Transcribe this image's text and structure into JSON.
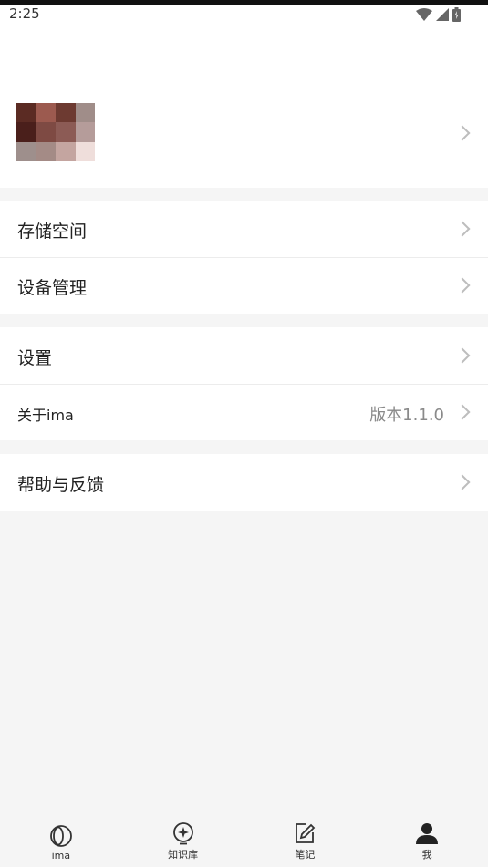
{
  "status_bar": {
    "time": "2:25",
    "icons": [
      "wifi-icon",
      "signal-icon",
      "battery-icon"
    ]
  },
  "profile": {
    "avatar_colors": [
      "#5b2b23",
      "#9c5a4f",
      "#6d3a31",
      "#a08d89",
      "#4a1f1b",
      "#7e4a43",
      "#8c5b55",
      "#b59c9a",
      "#9e8f8c",
      "#a48b86",
      "#c4a5a0",
      "#efdedb"
    ]
  },
  "menu": {
    "group1": [
      {
        "label": "存储空间"
      },
      {
        "label": "设备管理"
      }
    ],
    "group2": [
      {
        "label": "设置"
      },
      {
        "label": "关于ima",
        "value": "版本1.1.0"
      }
    ],
    "group3": [
      {
        "label": "帮助与反馈"
      }
    ]
  },
  "tabbar": {
    "tabs": [
      {
        "label": "ima",
        "icon": "ima-icon"
      },
      {
        "label": "知识库",
        "icon": "knowledge-base-icon"
      },
      {
        "label": "笔记",
        "icon": "note-icon"
      },
      {
        "label": "我",
        "icon": "profile-icon",
        "active": true
      }
    ]
  },
  "colors": {
    "background": "#f5f5f5",
    "card": "#ffffff",
    "chevron": "#bdbdbd",
    "secondary_text": "#8a8a8a"
  }
}
